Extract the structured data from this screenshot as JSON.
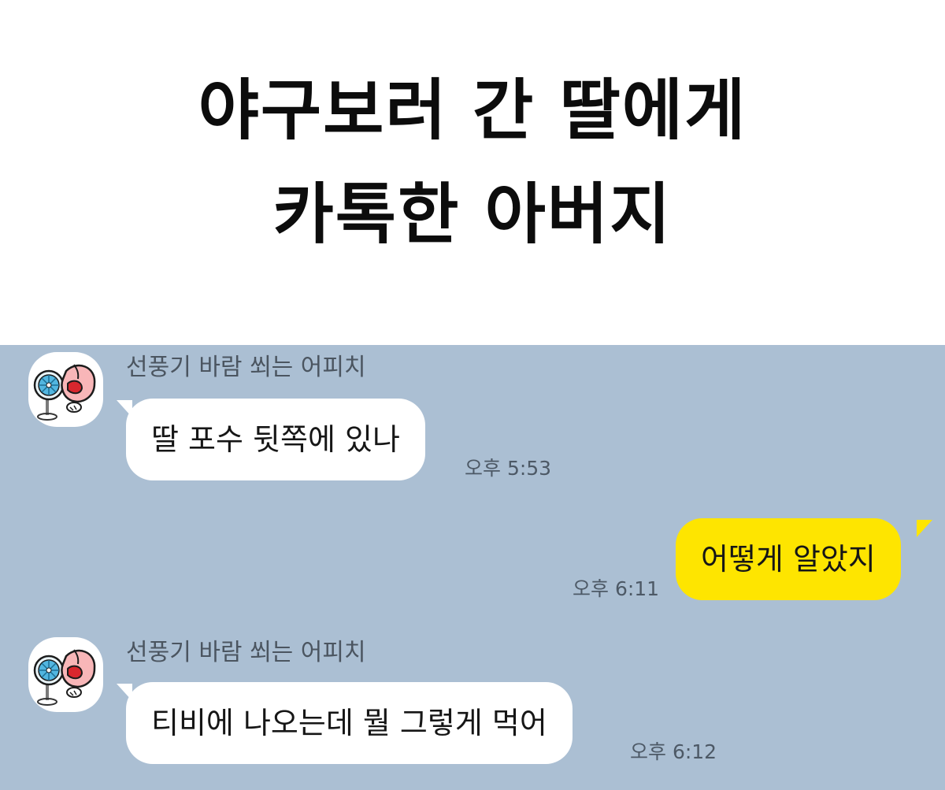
{
  "title": {
    "line1": "야구보러 간 딸에게",
    "line2": "카톡한 아버지"
  },
  "chat": {
    "background": "#abbfd3",
    "incoming_bubble_color": "#ffffff",
    "outgoing_bubble_color": "#fee500",
    "messages": [
      {
        "direction": "incoming",
        "sender": "선풍기 바람 쐬는 어피치",
        "avatar_icon": "apeach-fan-emoticon",
        "text": "딸 포수 뒷쪽에 있나",
        "time": "오후 5:53"
      },
      {
        "direction": "outgoing",
        "text": "어떻게 알았지",
        "time": "오후 6:11"
      },
      {
        "direction": "incoming",
        "sender": "선풍기 바람 쐬는 어피치",
        "avatar_icon": "apeach-fan-emoticon",
        "text": "티비에 나오는데 뭘 그렇게 먹어",
        "time": "오후 6:12"
      }
    ]
  }
}
